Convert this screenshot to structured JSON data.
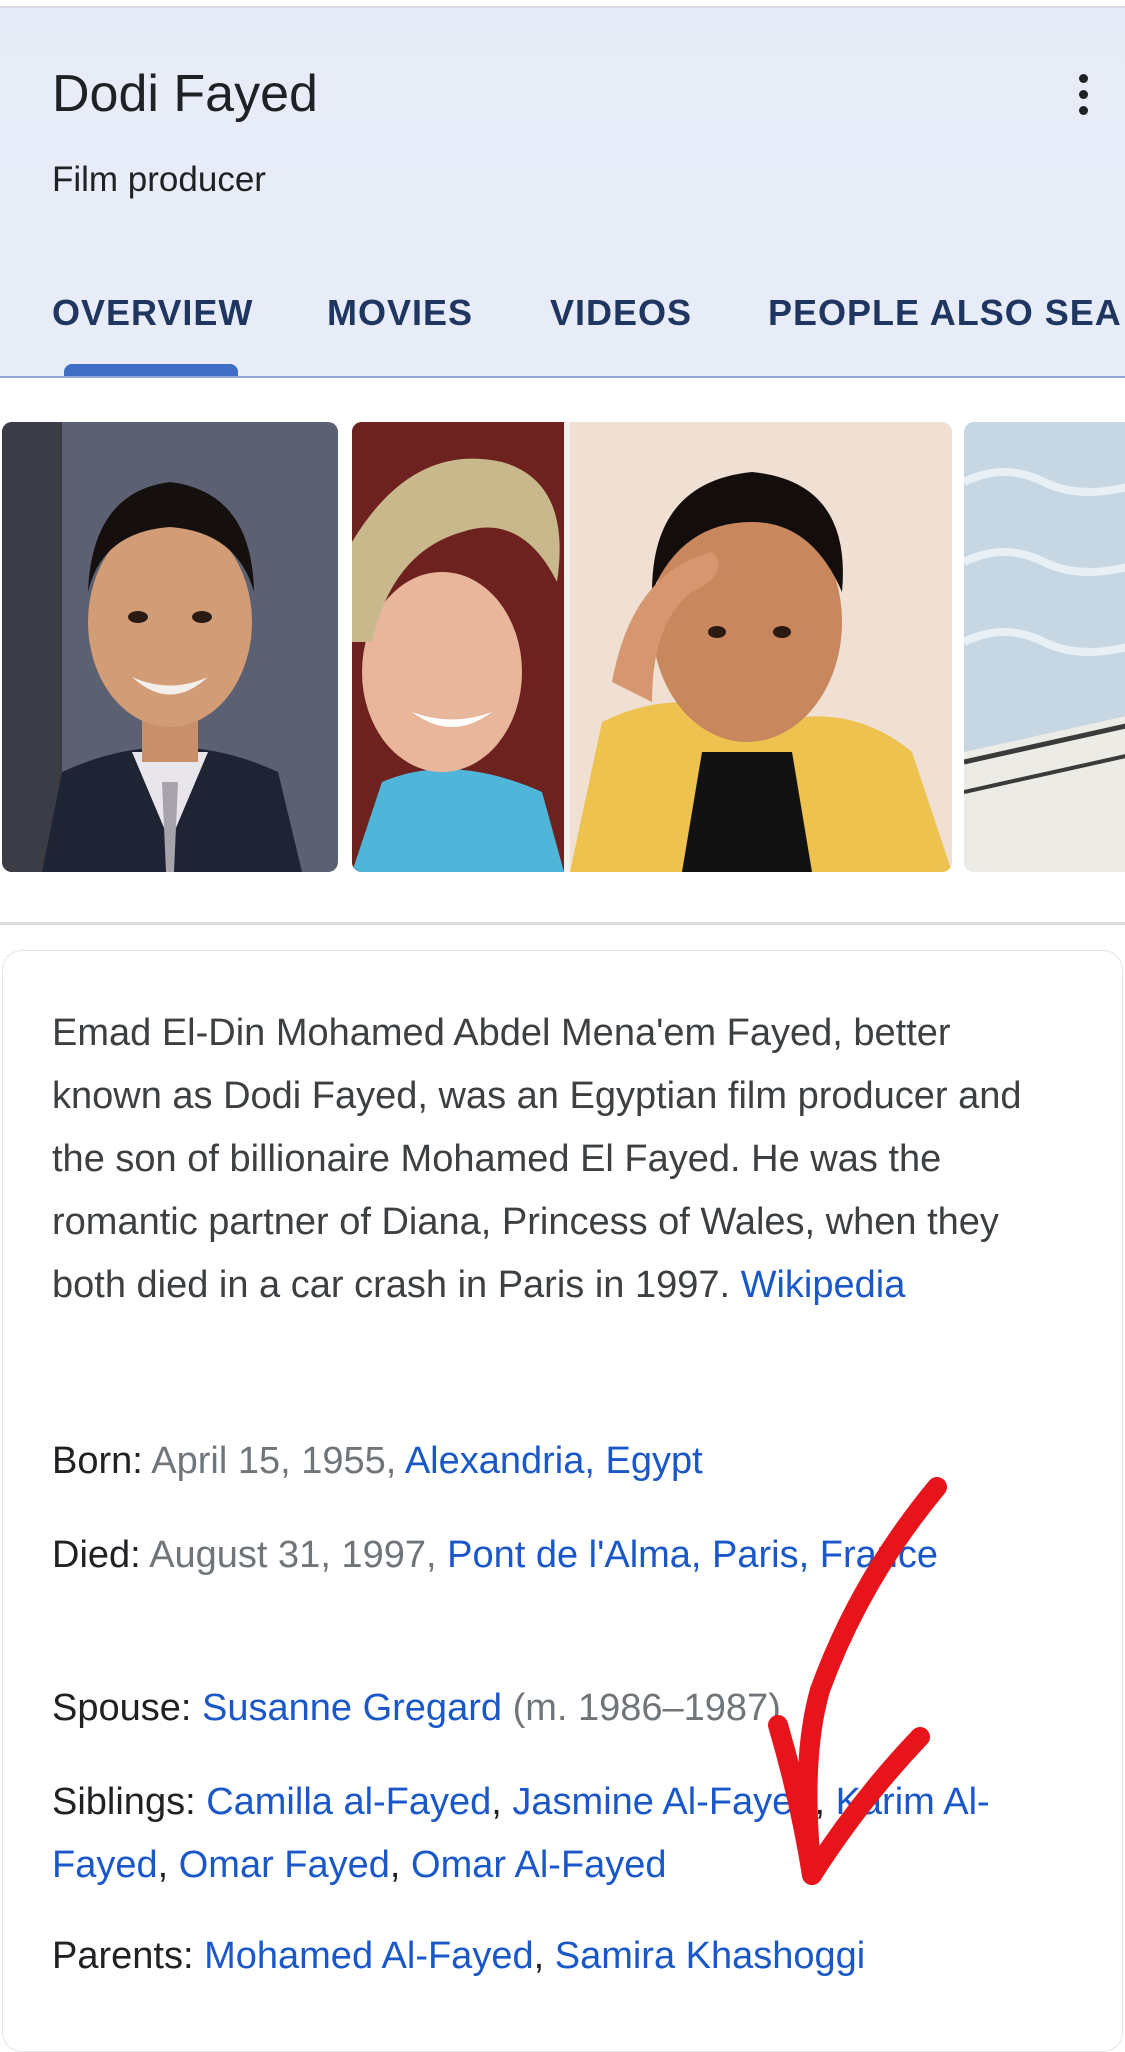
{
  "header": {
    "title": "Dodi Fayed",
    "subtitle": "Film producer",
    "tabs": [
      "OVERVIEW",
      "MOVIES",
      "VIDEOS",
      "PEOPLE ALSO SEA"
    ],
    "active_tab": "OVERVIEW",
    "more_icon": "more-vert-icon"
  },
  "description": {
    "text": "Emad El-Din Mohamed Abdel Mena'em Fayed, better known as Dodi Fayed, was an Egyptian film producer and the son of billionaire Mohamed El Fayed. He was the romantic partner of Diana, Princess of Wales, when they both died in a car crash in Paris in 1997.",
    "source": "Wikipedia"
  },
  "facts": {
    "born": {
      "label": "Born:",
      "date": "April 15, 1955,",
      "place": "Alexandria, Egypt"
    },
    "died": {
      "label": "Died:",
      "date": "August 31, 1997,",
      "place": "Pont de l'Alma, Paris, France"
    },
    "spouse": {
      "label": "Spouse:",
      "name": "Susanne Gregard",
      "note": "(m. 1986–1987)"
    },
    "siblings": {
      "label": "Siblings:",
      "names": [
        "Camilla al-Fayed",
        "Jasmine Al-Fayed",
        "Karim Al-Fayed",
        "Omar Fayed",
        "Omar Al-Fayed"
      ]
    },
    "parents": {
      "label": "Parents:",
      "names": [
        "Mohamed Al-Fayed",
        "Samira Khashoggi"
      ]
    }
  },
  "colors": {
    "link": "#1a57c9",
    "tab_text": "#1f3660",
    "tab_indicator": "#3f6cc4",
    "annotation_arrow": "#e8141c"
  }
}
